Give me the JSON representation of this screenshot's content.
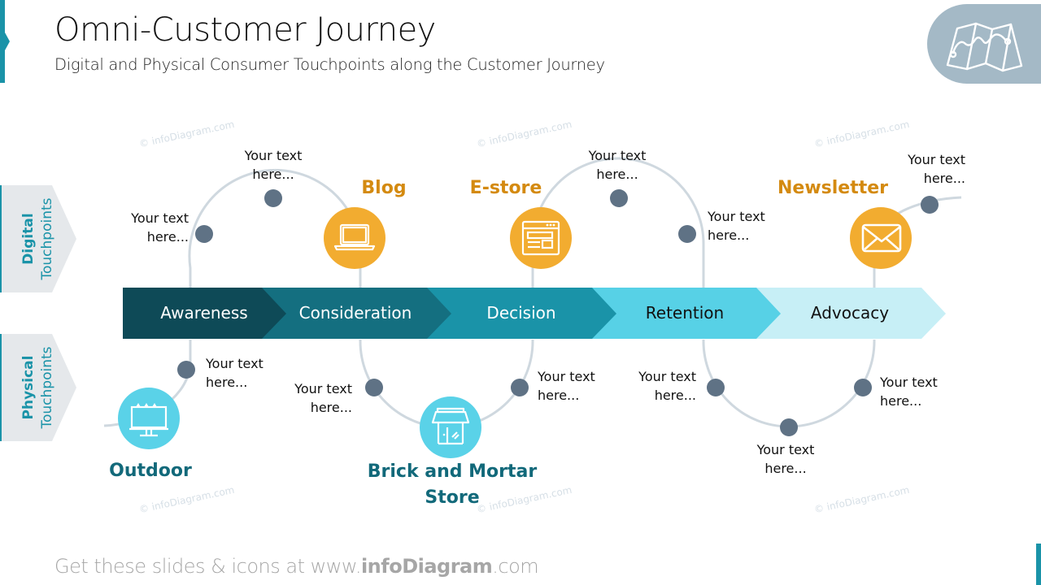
{
  "header": {
    "title": "Omni-Customer Journey",
    "subtitle": "Digital and Physical Consumer Touchpoints along the Customer Journey",
    "corner_icon": "map-icon"
  },
  "side_tabs": [
    {
      "bold": "Digital",
      "label": "Touchpoints"
    },
    {
      "bold": "Physical",
      "label": "Touchpoints"
    }
  ],
  "stages": [
    {
      "label": "Awareness",
      "color": "#0e4a57",
      "text_color": "#ffffff"
    },
    {
      "label": "Consideration",
      "color": "#146f80",
      "text_color": "#ffffff"
    },
    {
      "label": "Decision",
      "color": "#1a93a8",
      "text_color": "#ffffff"
    },
    {
      "label": "Retention",
      "color": "#57d1e6",
      "text_color": "#111111"
    },
    {
      "label": "Advocacy",
      "color": "#c7eff6",
      "text_color": "#111111"
    }
  ],
  "digital_touchpoints": [
    {
      "label": "Blog",
      "icon": "laptop-icon"
    },
    {
      "label": "E-store",
      "icon": "browser-window-icon"
    },
    {
      "label": "Newsletter",
      "icon": "envelope-icon"
    }
  ],
  "physical_touchpoints": [
    {
      "label": "Outdoor",
      "icon": "billboard-icon"
    },
    {
      "label": "Brick and Mortar Store",
      "icon": "storefront-icon"
    }
  ],
  "notes": {
    "placeholder": "Your text here...",
    "line1": "Your text",
    "line2": "here..."
  },
  "colors": {
    "digital_accent": "#f2ac30",
    "digital_label": "#d48a10",
    "physical_accent": "#5ad2e8",
    "physical_label": "#12697a",
    "dot": "#5f7285",
    "path": "#cfd8df"
  },
  "watermark": "© infoDiagram.com",
  "footer": {
    "prefix": "Get these slides & icons at www.",
    "brand": "infoDiagram",
    "suffix": ".com"
  }
}
